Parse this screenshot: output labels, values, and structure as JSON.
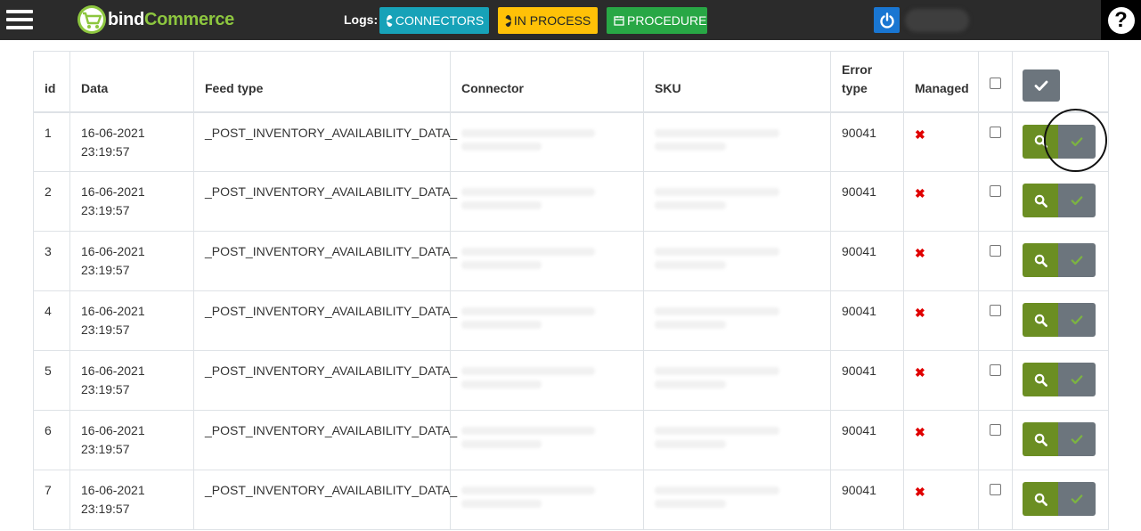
{
  "header": {
    "brand_part1": "bind",
    "brand_part2": "Commerce",
    "logs_label": "Logs:",
    "connectors_label": "CONNECTORS",
    "in_process_label": "IN PROCESS",
    "procedure_label": "PROCEDURE",
    "help_label": "?"
  },
  "table": {
    "columns": [
      "id",
      "Data",
      "Feed type",
      "Connector",
      "SKU",
      "Error type",
      "Managed"
    ],
    "error_type_line1": "Error",
    "error_type_line2": "type",
    "rows": [
      {
        "id": "1",
        "date": "16-06-2021",
        "time": "23:19:57",
        "feed_type": "_POST_INVENTORY_AVAILABILITY_DATA_",
        "error_type": "90041",
        "managed": "✖"
      },
      {
        "id": "2",
        "date": "16-06-2021",
        "time": "23:19:57",
        "feed_type": "_POST_INVENTORY_AVAILABILITY_DATA_",
        "error_type": "90041",
        "managed": "✖"
      },
      {
        "id": "3",
        "date": "16-06-2021",
        "time": "23:19:57",
        "feed_type": "_POST_INVENTORY_AVAILABILITY_DATA_",
        "error_type": "90041",
        "managed": "✖"
      },
      {
        "id": "4",
        "date": "16-06-2021",
        "time": "23:19:57",
        "feed_type": "_POST_INVENTORY_AVAILABILITY_DATA_",
        "error_type": "90041",
        "managed": "✖"
      },
      {
        "id": "5",
        "date": "16-06-2021",
        "time": "23:19:57",
        "feed_type": "_POST_INVENTORY_AVAILABILITY_DATA_",
        "error_type": "90041",
        "managed": "✖"
      },
      {
        "id": "6",
        "date": "16-06-2021",
        "time": "23:19:57",
        "feed_type": "_POST_INVENTORY_AVAILABILITY_DATA_",
        "error_type": "90041",
        "managed": "✖"
      },
      {
        "id": "7",
        "date": "16-06-2021",
        "time": "23:19:57",
        "feed_type": "_POST_INVENTORY_AVAILABILITY_DATA_",
        "error_type": "90041",
        "managed": "✖"
      }
    ]
  },
  "colors": {
    "topbar": "#2b2b2b",
    "connectors": "#17a2b8",
    "in_process": "#ffc107",
    "procedure": "#28a745",
    "search_button": "#6b8e23",
    "check_button": "#6c757d",
    "not_managed": "#e00000"
  },
  "icons": {
    "menu": "hamburger-icon",
    "logo": "shopping-cart-icon",
    "connectors": "arrow-circle-left-icon",
    "in_process": "arrow-circle-right-icon",
    "procedure": "calendar-icon",
    "logout": "power-icon",
    "help": "question-circle-icon",
    "view": "search-icon",
    "manage": "check-icon",
    "managed_no": "times-icon"
  }
}
